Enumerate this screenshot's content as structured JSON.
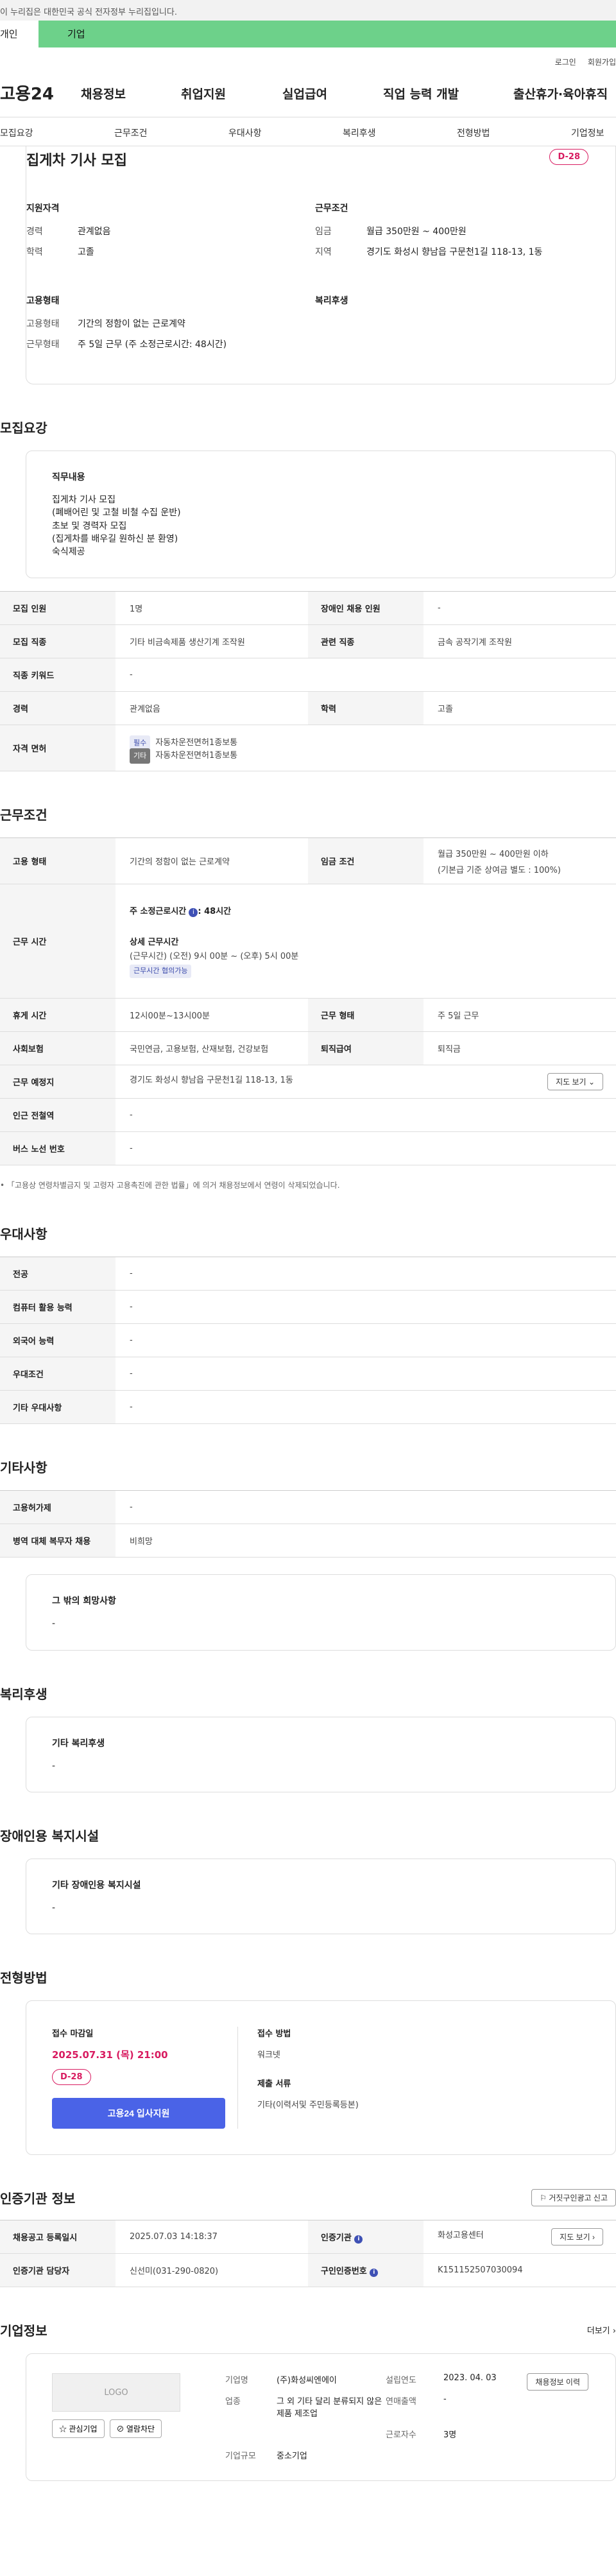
{
  "gov_bar": {
    "text": "이 누리집은 대한민국 공식 전자정부 누리집입니다."
  },
  "svc_tabs": {
    "personal": "개인",
    "corporate": "기업"
  },
  "util": {
    "login": "로그인",
    "join": "회원가입"
  },
  "logo": "고용24",
  "gnb": [
    "채용정보",
    "취업지원",
    "실업급여",
    "직업 능력 개발",
    "출산휴가·육아휴직"
  ],
  "lnb": [
    "모집요강",
    "근무조건",
    "우대사항",
    "복리후생",
    "전형방법",
    "기업정보"
  ],
  "summary": {
    "title": "집게차 기사 모집",
    "dday": "D-28",
    "qual_h": "지원자격",
    "career_k": "경력",
    "career_v": "관계없음",
    "edu_k": "학력",
    "edu_v": "고졸",
    "cond_h": "근무조건",
    "wage_k": "임금",
    "wage_v": "월급 350만원 ~ 400만원",
    "loc_k": "지역",
    "loc_v": "경기도 화성시 향남읍 구문천1길 118-13, 1동",
    "emp_h": "고용형태",
    "emptype_k": "고용형태",
    "emptype_v": "기간의 정함이 없는 근로계약",
    "workform_k": "근무형태",
    "workform_v": "주 5일 근무 (주 소정근로시간: 48시간)",
    "welfare_h": "복리후생"
  },
  "recruit": {
    "title": "모집요강",
    "duty_h": "직무내용",
    "duty_text": "집게차 기사 모집\n(폐배어린 및 고철 비철 수집 운반)\n초보 및 경력자 모집\n(집게차를 배우길 원하신 분 환영)\n숙식제공",
    "rows": {
      "headcount_k": "모집 인원",
      "headcount_v": "1명",
      "disabled_k": "장애인 채용 인원",
      "disabled_v": "-",
      "job_k": "모집 직종",
      "job_v": "기타 비금속제품 생산기계 조작원",
      "rel_k": "관련 직종",
      "rel_v": "금속 공작기계 조작원",
      "kw_k": "직종 키워드",
      "kw_v": "-",
      "career_k": "경력",
      "career_v": "관계없음",
      "edu_k": "학력",
      "edu_v": "고졸",
      "lic_k": "자격 면허",
      "lic1_tag": "필수",
      "lic1_v": "자동차운전면허1종보통",
      "lic2_tag": "기타",
      "lic2_v": "자동차운전면허1종보통"
    }
  },
  "work": {
    "title": "근무조건",
    "emptype_k": "고용 형태",
    "emptype_v": "기간의 정함이 없는 근로계약",
    "wage_k": "임금 조건",
    "wage_v1": "월급 350만원 ~ 400만원 이하",
    "wage_v2": "(기본급 기준 상여금 별도 : 100%)",
    "time_k": "근무 시간",
    "time_main": "주 소정근로시간",
    "time_main_v": ": 48시간",
    "time_detail_h": "상세 근무시간",
    "time_detail_v": "(근무시간) (오전) 9시 00분 ~ (오후) 5시 00분",
    "time_pill": "근무시간 협의가능",
    "break_k": "휴게 시간",
    "break_v": "12시00분~13시00분",
    "form_k": "근무 형태",
    "form_v": "주 5일 근무",
    "ins_k": "사회보험",
    "ins_v": "국민연금, 고용보험, 산재보험, 건강보험",
    "retire_k": "퇴직급여",
    "retire_v": "퇴직금",
    "place_k": "근무 예정지",
    "place_v": "경기도 화성시 향남읍 구문천1길 118-13, 1동",
    "map_btn": "지도 보기",
    "station_k": "인근 전철역",
    "station_v": "-",
    "bus_k": "버스 노선 번호",
    "bus_v": "-",
    "note": "「고용상 연령차별금지 및 고령자 고용촉진에 관한 법률」에 의거 채용정보에서 연령이 삭제되었습니다."
  },
  "pref": {
    "title": "우대사항",
    "major_k": "전공",
    "major_v": "-",
    "pc_k": "컴퓨터 활용 능력",
    "pc_v": "-",
    "lang_k": "외국어 능력",
    "lang_v": "-",
    "cond_k": "우대조건",
    "cond_v": "-",
    "etc_k": "기타 우대사항",
    "etc_v": "-"
  },
  "etc": {
    "title": "기타사항",
    "permit_k": "고용허가제",
    "permit_v": "-",
    "mil_k": "병역 대체 복무자 채용",
    "mil_v": "비희망",
    "wish_h": "그 밖의 희망사항",
    "wish_v": "-"
  },
  "welfare": {
    "title": "복리후생",
    "h": "기타 복리후생",
    "v": "-"
  },
  "disabled": {
    "title": "장애인용 복지시설",
    "h": "기타 장애인용 복지시설",
    "v": "-"
  },
  "apply": {
    "title": "전형방법",
    "deadline_h": "접수 마감일",
    "deadline_v": "2025.07.31 (목) 21:00",
    "dday": "D-28",
    "btn": "고용24 입사지원",
    "method_h": "접수 방법",
    "method_v": "워크넷",
    "docs_h": "제출 서류",
    "docs_v": "기타(이력서및 주민등록등본)"
  },
  "cert": {
    "title": "인증기관 정보",
    "report_btn": "거짓구인광고 신고",
    "reg_k": "채용공고 등록일시",
    "reg_v": "2025.07.03 14:18:37",
    "org_k": "인증기관",
    "org_v": "화성고용센터",
    "map_btn": "지도 보기",
    "mgr_k": "인증기관 담당자",
    "mgr_v": "신선미(031-290-0820)",
    "no_k": "구인인증번호",
    "no_v": "K151152507030094"
  },
  "corp": {
    "title": "기업정보",
    "more": "더보기",
    "logo_text": "LOGO",
    "fav_btn": "관심기업",
    "block_btn": "열람차단",
    "name_k": "기업명",
    "name_v": "(주)화성씨엔에이",
    "founded_k": "설립연도",
    "founded_v": "2023. 04. 03",
    "jobs_btn": "채용정보 이력",
    "industry_k": "업종",
    "industry_v": "그 외 기타 달리 분류되지 않은 제품 제조업",
    "sales_k": "연매출액",
    "sales_v": "-",
    "staff_k": "근로자수",
    "staff_v": "3명",
    "size_k": "기업규모",
    "size_v": "중소기업"
  }
}
